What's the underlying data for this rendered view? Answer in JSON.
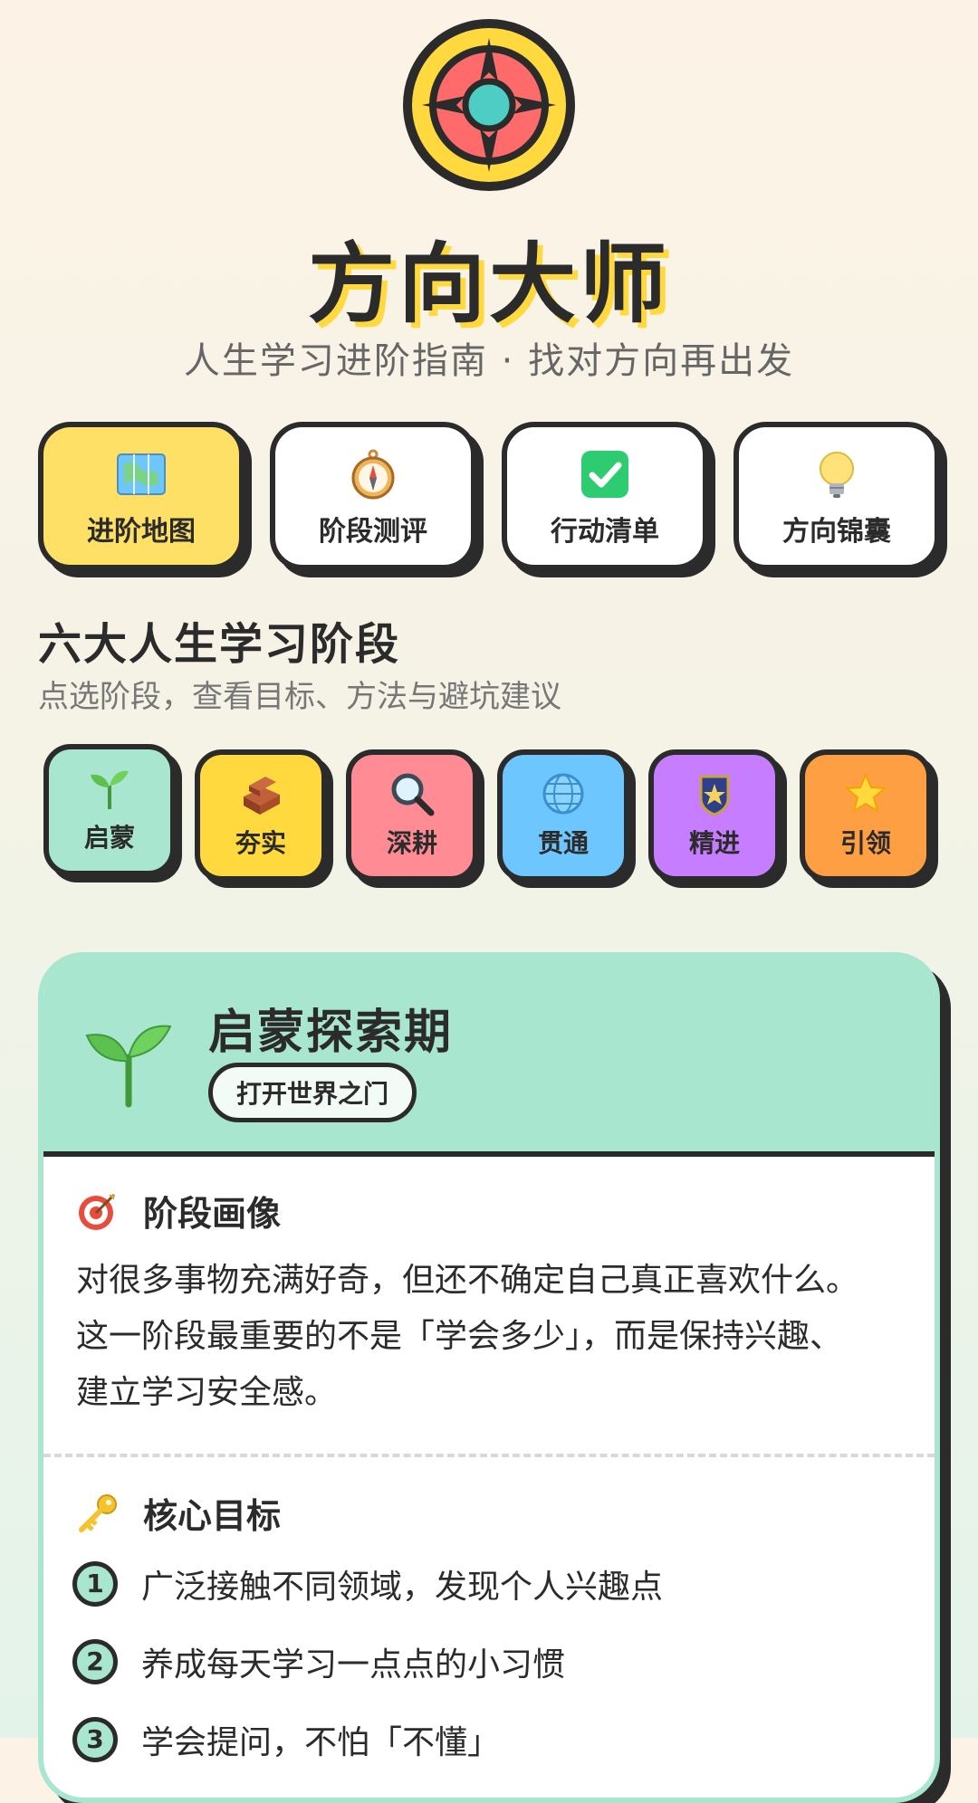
{
  "app": {
    "title": "方向大师",
    "subtitle": "人生学习进阶指南 · 找对方向再出发"
  },
  "tabs": [
    {
      "label": "进阶地图",
      "icon": "map-icon",
      "active": true
    },
    {
      "label": "阶段测评",
      "icon": "compass-icon",
      "active": false
    },
    {
      "label": "行动清单",
      "icon": "checkmark-icon",
      "active": false
    },
    {
      "label": "方向锦囊",
      "icon": "lightbulb-icon",
      "active": false
    }
  ],
  "section": {
    "title": "六大人生学习阶段",
    "subtitle": "点选阶段，查看目标、方法与避坑建议"
  },
  "stages": [
    {
      "label": "启蒙",
      "icon": "seedling-icon",
      "color": "#a8e6cf",
      "active": true
    },
    {
      "label": "夯实",
      "icon": "bricks-icon",
      "color": "#ffd93d",
      "active": false
    },
    {
      "label": "深耕",
      "icon": "magnifier-icon",
      "color": "#ff8b94",
      "active": false
    },
    {
      "label": "贯通",
      "icon": "globe-icon",
      "color": "#6ec6ff",
      "active": false
    },
    {
      "label": "精进",
      "icon": "badge-icon",
      "color": "#c77dff",
      "active": false
    },
    {
      "label": "引领",
      "icon": "star-icon",
      "color": "#ff9f43",
      "active": false
    }
  ],
  "card": {
    "title": "启蒙探索期",
    "badge": "打开世界之门",
    "accent": "#a8e6cf",
    "portrait": {
      "title": "阶段画像",
      "icon": "target-icon",
      "lines": [
        "对很多事物充满好奇，但还不确定自己真正喜欢什么。",
        "这一阶段最重要的不是「学会多少」，而是保持兴趣、",
        "建立学习安全感。"
      ]
    },
    "goals": {
      "title": "核心目标",
      "icon": "key-icon",
      "items": [
        {
          "num": "1",
          "text": "广泛接触不同领域，发现个人兴趣点"
        },
        {
          "num": "2",
          "text": "养成每天学习一点点的小习惯"
        },
        {
          "num": "3",
          "text": "学会提问，不怕「不懂」"
        }
      ]
    }
  }
}
